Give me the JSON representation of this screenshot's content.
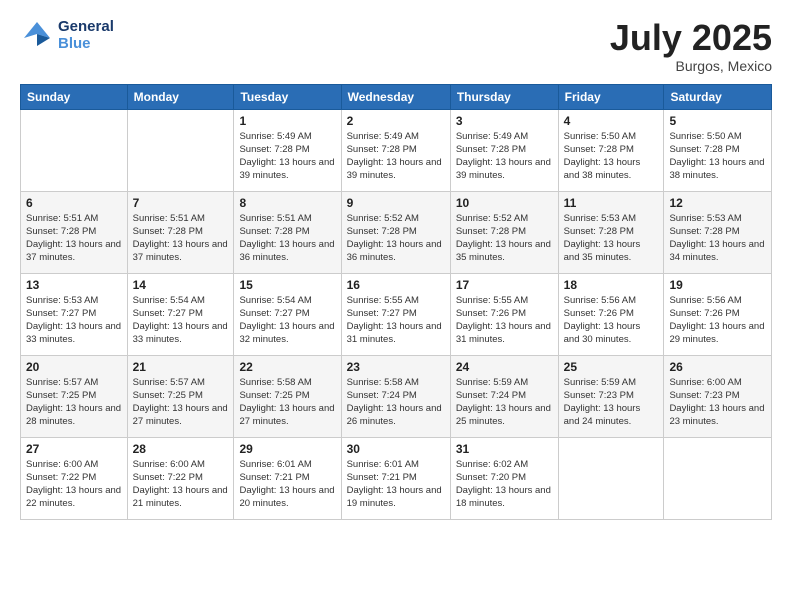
{
  "header": {
    "logo_line1": "General",
    "logo_line2": "Blue",
    "month": "July 2025",
    "location": "Burgos, Mexico"
  },
  "weekdays": [
    "Sunday",
    "Monday",
    "Tuesday",
    "Wednesday",
    "Thursday",
    "Friday",
    "Saturday"
  ],
  "weeks": [
    [
      {
        "day": "",
        "info": ""
      },
      {
        "day": "",
        "info": ""
      },
      {
        "day": "1",
        "info": "Sunrise: 5:49 AM\nSunset: 7:28 PM\nDaylight: 13 hours and 39 minutes."
      },
      {
        "day": "2",
        "info": "Sunrise: 5:49 AM\nSunset: 7:28 PM\nDaylight: 13 hours and 39 minutes."
      },
      {
        "day": "3",
        "info": "Sunrise: 5:49 AM\nSunset: 7:28 PM\nDaylight: 13 hours and 39 minutes."
      },
      {
        "day": "4",
        "info": "Sunrise: 5:50 AM\nSunset: 7:28 PM\nDaylight: 13 hours and 38 minutes."
      },
      {
        "day": "5",
        "info": "Sunrise: 5:50 AM\nSunset: 7:28 PM\nDaylight: 13 hours and 38 minutes."
      }
    ],
    [
      {
        "day": "6",
        "info": "Sunrise: 5:51 AM\nSunset: 7:28 PM\nDaylight: 13 hours and 37 minutes."
      },
      {
        "day": "7",
        "info": "Sunrise: 5:51 AM\nSunset: 7:28 PM\nDaylight: 13 hours and 37 minutes."
      },
      {
        "day": "8",
        "info": "Sunrise: 5:51 AM\nSunset: 7:28 PM\nDaylight: 13 hours and 36 minutes."
      },
      {
        "day": "9",
        "info": "Sunrise: 5:52 AM\nSunset: 7:28 PM\nDaylight: 13 hours and 36 minutes."
      },
      {
        "day": "10",
        "info": "Sunrise: 5:52 AM\nSunset: 7:28 PM\nDaylight: 13 hours and 35 minutes."
      },
      {
        "day": "11",
        "info": "Sunrise: 5:53 AM\nSunset: 7:28 PM\nDaylight: 13 hours and 35 minutes."
      },
      {
        "day": "12",
        "info": "Sunrise: 5:53 AM\nSunset: 7:28 PM\nDaylight: 13 hours and 34 minutes."
      }
    ],
    [
      {
        "day": "13",
        "info": "Sunrise: 5:53 AM\nSunset: 7:27 PM\nDaylight: 13 hours and 33 minutes."
      },
      {
        "day": "14",
        "info": "Sunrise: 5:54 AM\nSunset: 7:27 PM\nDaylight: 13 hours and 33 minutes."
      },
      {
        "day": "15",
        "info": "Sunrise: 5:54 AM\nSunset: 7:27 PM\nDaylight: 13 hours and 32 minutes."
      },
      {
        "day": "16",
        "info": "Sunrise: 5:55 AM\nSunset: 7:27 PM\nDaylight: 13 hours and 31 minutes."
      },
      {
        "day": "17",
        "info": "Sunrise: 5:55 AM\nSunset: 7:26 PM\nDaylight: 13 hours and 31 minutes."
      },
      {
        "day": "18",
        "info": "Sunrise: 5:56 AM\nSunset: 7:26 PM\nDaylight: 13 hours and 30 minutes."
      },
      {
        "day": "19",
        "info": "Sunrise: 5:56 AM\nSunset: 7:26 PM\nDaylight: 13 hours and 29 minutes."
      }
    ],
    [
      {
        "day": "20",
        "info": "Sunrise: 5:57 AM\nSunset: 7:25 PM\nDaylight: 13 hours and 28 minutes."
      },
      {
        "day": "21",
        "info": "Sunrise: 5:57 AM\nSunset: 7:25 PM\nDaylight: 13 hours and 27 minutes."
      },
      {
        "day": "22",
        "info": "Sunrise: 5:58 AM\nSunset: 7:25 PM\nDaylight: 13 hours and 27 minutes."
      },
      {
        "day": "23",
        "info": "Sunrise: 5:58 AM\nSunset: 7:24 PM\nDaylight: 13 hours and 26 minutes."
      },
      {
        "day": "24",
        "info": "Sunrise: 5:59 AM\nSunset: 7:24 PM\nDaylight: 13 hours and 25 minutes."
      },
      {
        "day": "25",
        "info": "Sunrise: 5:59 AM\nSunset: 7:23 PM\nDaylight: 13 hours and 24 minutes."
      },
      {
        "day": "26",
        "info": "Sunrise: 6:00 AM\nSunset: 7:23 PM\nDaylight: 13 hours and 23 minutes."
      }
    ],
    [
      {
        "day": "27",
        "info": "Sunrise: 6:00 AM\nSunset: 7:22 PM\nDaylight: 13 hours and 22 minutes."
      },
      {
        "day": "28",
        "info": "Sunrise: 6:00 AM\nSunset: 7:22 PM\nDaylight: 13 hours and 21 minutes."
      },
      {
        "day": "29",
        "info": "Sunrise: 6:01 AM\nSunset: 7:21 PM\nDaylight: 13 hours and 20 minutes."
      },
      {
        "day": "30",
        "info": "Sunrise: 6:01 AM\nSunset: 7:21 PM\nDaylight: 13 hours and 19 minutes."
      },
      {
        "day": "31",
        "info": "Sunrise: 6:02 AM\nSunset: 7:20 PM\nDaylight: 13 hours and 18 minutes."
      },
      {
        "day": "",
        "info": ""
      },
      {
        "day": "",
        "info": ""
      }
    ]
  ]
}
